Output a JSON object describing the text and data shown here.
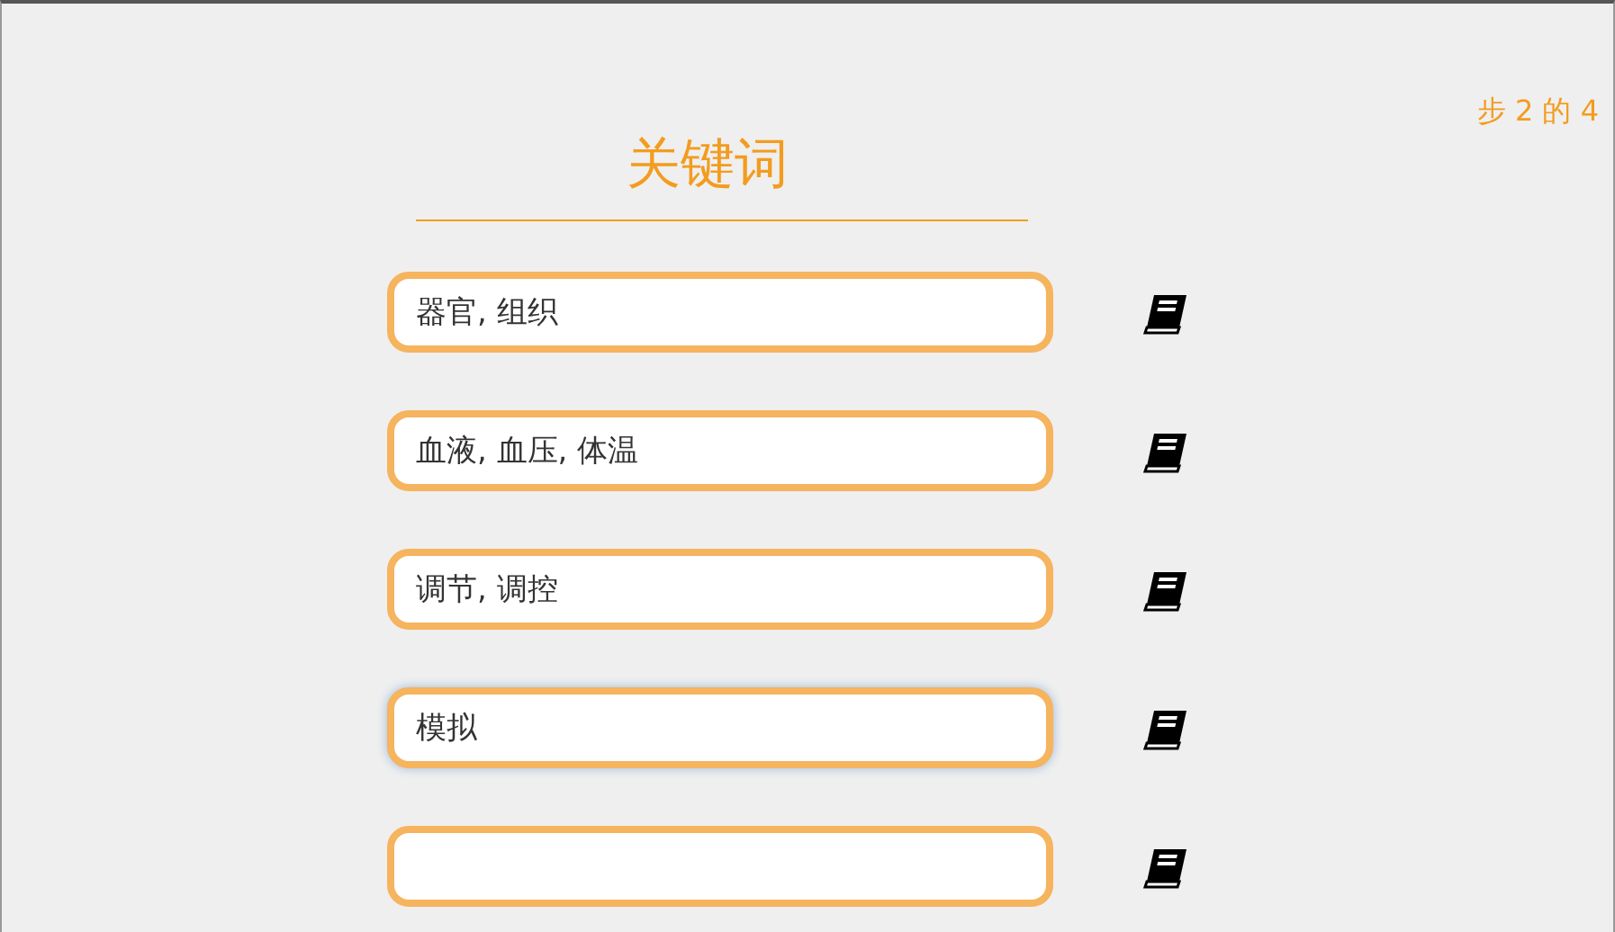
{
  "step": "步 2 的 4",
  "title": "关键词",
  "fields": [
    {
      "value": "器官, 组织",
      "focused": false
    },
    {
      "value": "血液, 血压, 体温",
      "focused": false
    },
    {
      "value": "调节, 调控",
      "focused": false
    },
    {
      "value": "模拟",
      "focused": true
    },
    {
      "focused": false
    }
  ]
}
